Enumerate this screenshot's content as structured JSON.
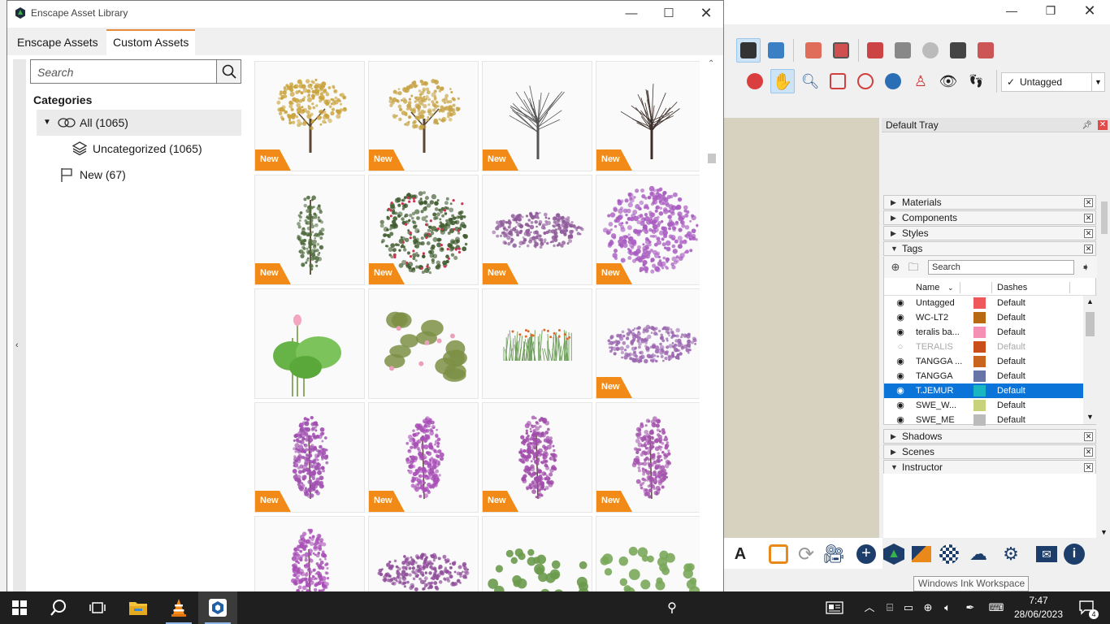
{
  "asset_library": {
    "title": "Enscape Asset Library",
    "tabs": [
      {
        "label": "Enscape Assets"
      },
      {
        "label": "Custom Assets"
      }
    ],
    "search_placeholder": "Search",
    "categories_title": "Categories",
    "categories": [
      {
        "label": "All (1065)"
      },
      {
        "label": "Uncategorized (1065)"
      },
      {
        "label": "New (67)"
      }
    ],
    "badge_label": "New",
    "assets": [
      {
        "kind": "tree",
        "color": "#c9a23a",
        "new": true
      },
      {
        "kind": "tree",
        "color": "#c7a447",
        "new": true
      },
      {
        "kind": "bare-tree",
        "color": "#555555",
        "new": true
      },
      {
        "kind": "bare-tree",
        "color": "#3c2f2a",
        "new": true
      },
      {
        "kind": "slim-tree",
        "color": "#4f6b3d",
        "new": true
      },
      {
        "kind": "vine",
        "color": "#3f5b2e",
        "new": true
      },
      {
        "kind": "low-shrub",
        "color": "#8f5a9a",
        "new": true
      },
      {
        "kind": "bush",
        "color": "#a85cc0",
        "new": true
      },
      {
        "kind": "lotus",
        "color": "#68b347",
        "new": false
      },
      {
        "kind": "lily-pads",
        "color": "#7c8f45",
        "new": false
      },
      {
        "kind": "grass",
        "color": "#6e9e5a",
        "new": false
      },
      {
        "kind": "low-shrub",
        "color": "#9b67b0",
        "new": true
      },
      {
        "kind": "bougainvillea",
        "color": "#a04fb0",
        "new": true
      },
      {
        "kind": "bougainvillea",
        "color": "#a84fb6",
        "new": true
      },
      {
        "kind": "bougainvillea",
        "color": "#a04caa",
        "new": true
      },
      {
        "kind": "bougainvillea",
        "color": "#a454ad",
        "new": true
      },
      {
        "kind": "bougainvillea",
        "color": "#a84fb6",
        "new": false
      },
      {
        "kind": "low-shrub",
        "color": "#8f4e9a",
        "new": false
      },
      {
        "kind": "ivy",
        "color": "#6a9a4c",
        "new": false
      },
      {
        "kind": "ivy",
        "color": "#7aa85a",
        "new": false
      }
    ]
  },
  "sketchup": {
    "tag_dropdown": "Untagged",
    "tray_title": "Default Tray",
    "panels": {
      "materials": "Materials",
      "components": "Components",
      "styles": "Styles",
      "tags": "Tags",
      "shadows": "Shadows",
      "scenes": "Scenes",
      "instructor": "Instructor"
    },
    "tags_search_placeholder": "Search",
    "tags_columns": {
      "name": "Name",
      "dashes": "Dashes"
    },
    "tags": [
      {
        "name": "Untagged",
        "color": "#f0575a",
        "dashes": "Default",
        "visible": true,
        "selected": false
      },
      {
        "name": "WC-LT2",
        "color": "#b86a12",
        "dashes": "Default",
        "visible": true,
        "selected": false
      },
      {
        "name": "teralis ba...",
        "color": "#f58fb3",
        "dashes": "Default",
        "visible": true,
        "selected": false
      },
      {
        "name": "TERALIS",
        "color": "#c84f1a",
        "dashes": "Default",
        "visible": false,
        "selected": false
      },
      {
        "name": "TANGGA ...",
        "color": "#c8651e",
        "dashes": "Default",
        "visible": true,
        "selected": false
      },
      {
        "name": "TANGGA",
        "color": "#6675a5",
        "dashes": "Default",
        "visible": true,
        "selected": false
      },
      {
        "name": "T.JEMUR",
        "color": "#18b6c0",
        "dashes": "Default",
        "visible": true,
        "selected": true
      },
      {
        "name": "SWE_W...",
        "color": "#c8d27a",
        "dashes": "Default",
        "visible": true,
        "selected": false
      },
      {
        "name": "SWE_ME",
        "color": "#bbbbbb",
        "dashes": "Default",
        "visible": true,
        "selected": false
      }
    ],
    "tooltip": "Windows Ink Workspace"
  },
  "taskbar": {
    "time": "7:47",
    "date": "28/06/2023",
    "notification_count": "4"
  }
}
